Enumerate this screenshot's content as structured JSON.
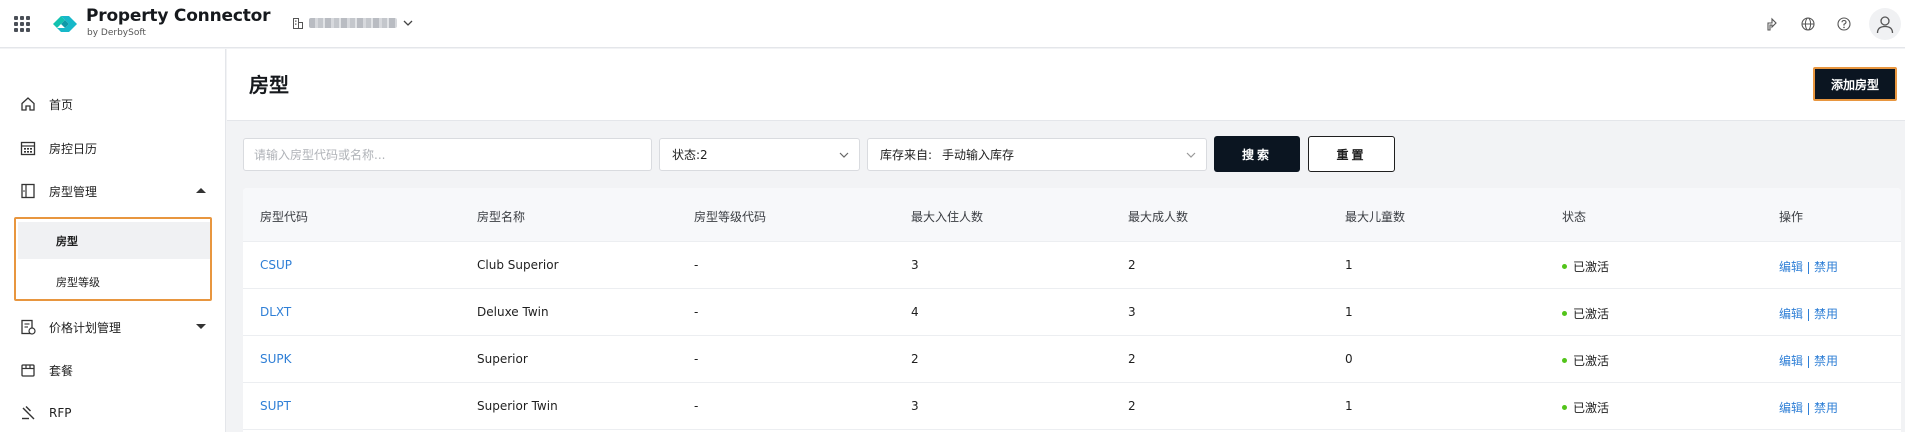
{
  "app": {
    "title": "Property Connector",
    "subtitle": "by DerbySoft"
  },
  "colors": {
    "accent": "#2f7fd6",
    "primary_button": "#0b1521",
    "highlight": "#e8963f",
    "status_active": "#52c41a",
    "logo_teal": "#12c2b0"
  },
  "icons": {
    "apps": "apps-grid-icon",
    "property": "building-icon",
    "share": "share-icon",
    "language": "globe-icon",
    "help": "help-icon",
    "user": "user-avatar-icon"
  },
  "sidebar": {
    "items": [
      {
        "label": "首页",
        "icon": "home-icon"
      },
      {
        "label": "房控日历",
        "icon": "calendar-icon"
      },
      {
        "label": "房型管理",
        "icon": "room-type-icon",
        "expanded": true
      },
      {
        "label": "价格计划管理",
        "icon": "rate-plan-icon",
        "expanded": false
      },
      {
        "label": "套餐",
        "icon": "package-icon"
      },
      {
        "label": "RFP",
        "icon": "rfp-icon"
      }
    ],
    "sub_items": [
      {
        "label": "房型",
        "active": true
      },
      {
        "label": "房型等级",
        "active": false
      }
    ]
  },
  "page": {
    "title": "房型",
    "add_button": "添加房型"
  },
  "filters": {
    "search_placeholder": "请输入房型代码或名称...",
    "search_value": "",
    "status_label": "状态:",
    "status_value": "2",
    "inventory_label": "库存来自:",
    "inventory_value": "手动输入库存",
    "search_button": "搜索",
    "reset_button": "重置"
  },
  "table": {
    "columns": [
      "房型代码",
      "房型名称",
      "房型等级代码",
      "最大入住人数",
      "最大成人数",
      "最大儿童数",
      "状态",
      "操作"
    ],
    "rows": [
      {
        "code": "CSUP",
        "name": "Club Superior",
        "level": "-",
        "max_occupancy": "3",
        "max_adults": "2",
        "max_children": "1",
        "status": "已激活",
        "edit": "编辑",
        "disable": "禁用"
      },
      {
        "code": "DLXT",
        "name": "Deluxe Twin",
        "level": "-",
        "max_occupancy": "4",
        "max_adults": "3",
        "max_children": "1",
        "status": "已激活",
        "edit": "编辑",
        "disable": "禁用"
      },
      {
        "code": "SUPK",
        "name": "Superior",
        "level": "-",
        "max_occupancy": "2",
        "max_adults": "2",
        "max_children": "0",
        "status": "已激活",
        "edit": "编辑",
        "disable": "禁用"
      },
      {
        "code": "SUPT",
        "name": "Superior Twin",
        "level": "-",
        "max_occupancy": "3",
        "max_adults": "2",
        "max_children": "1",
        "status": "已激活",
        "edit": "编辑",
        "disable": "禁用"
      }
    ]
  }
}
